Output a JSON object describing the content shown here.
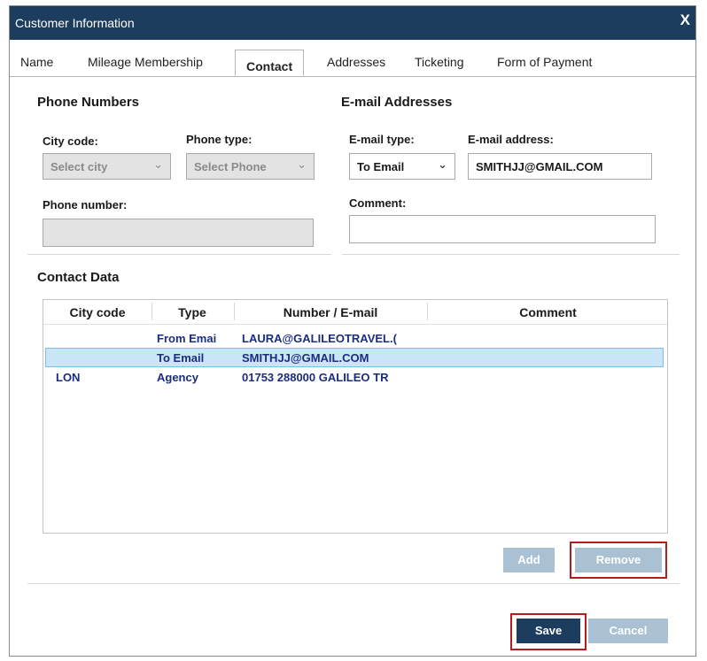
{
  "window": {
    "title": "Customer Information",
    "close_label": "X"
  },
  "tabs": [
    {
      "label": "Name"
    },
    {
      "label": "Mileage Membership"
    },
    {
      "label": "Contact"
    },
    {
      "label": "Addresses"
    },
    {
      "label": "Ticketing"
    },
    {
      "label": "Form of Payment"
    }
  ],
  "phone": {
    "section_title": "Phone Numbers",
    "city_code_label": "City code:",
    "city_code_value": "Select city",
    "phone_type_label": "Phone type:",
    "phone_type_value": "Select Phone",
    "phone_number_label": "Phone number:",
    "phone_number_value": ""
  },
  "email": {
    "section_title": "E-mail Addresses",
    "type_label": "E-mail type:",
    "type_value": "To Email",
    "address_label": "E-mail address:",
    "address_value": "SMITHJJ@GMAIL.COM",
    "comment_label": "Comment:",
    "comment_value": ""
  },
  "contact_data": {
    "section_title": "Contact Data",
    "columns": [
      "City code",
      "Type",
      "Number / E-mail",
      "Comment"
    ],
    "rows": [
      {
        "city": "",
        "type": "From Emai",
        "number": "LAURA@GALILEOTRAVEL.(",
        "comment": "",
        "selected": false
      },
      {
        "city": "",
        "type": "To Email",
        "number": "SMITHJJ@GMAIL.COM",
        "comment": "",
        "selected": true
      },
      {
        "city": "LON",
        "type": "Agency",
        "number": "01753 288000 GALILEO TR",
        "comment": "",
        "selected": false
      }
    ]
  },
  "buttons": {
    "add": "Add",
    "remove": "Remove",
    "save": "Save",
    "cancel": "Cancel"
  },
  "colors": {
    "titlebar": "#1d3d5f",
    "row_text": "#1b2d80",
    "selected_row": "#c8e6f7",
    "highlight": "#b51d1d",
    "button_disabled": "#a9c1d3"
  }
}
